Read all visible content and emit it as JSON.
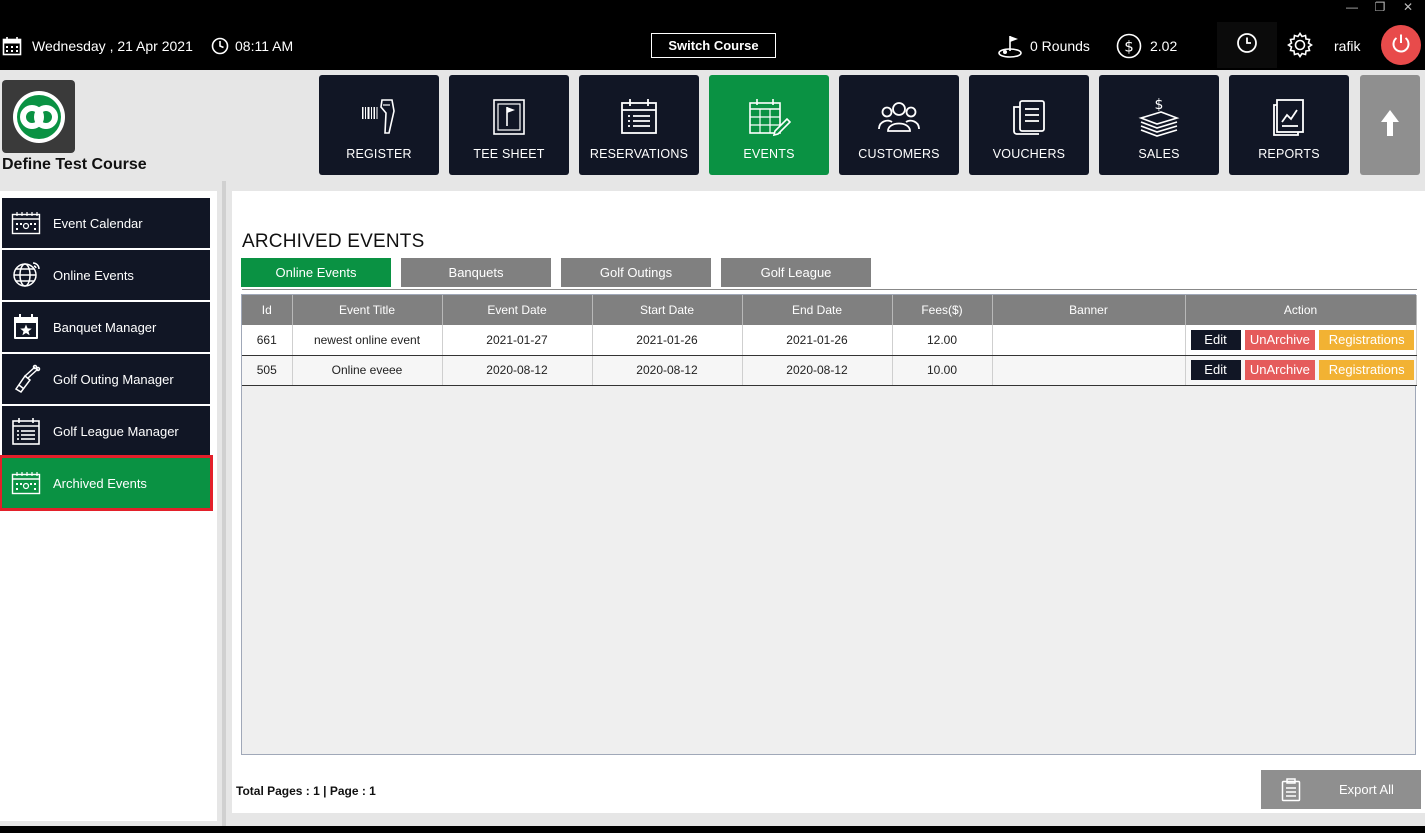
{
  "topbar": {
    "date": "Wednesday ,  21 Apr 2021",
    "time": "08:11 AM",
    "switch_course": "Switch Course",
    "rounds": "0 Rounds",
    "balance": "2.02",
    "user": "rafik",
    "window_controls": [
      "minimize-icon",
      "restore-icon",
      "close-icon"
    ]
  },
  "header": {
    "course_name": "Define Test Course",
    "nav": [
      {
        "label": "REGISTER",
        "icon": "barcode-scanner-icon"
      },
      {
        "label": "TEE SHEET",
        "icon": "flag-sheet-icon"
      },
      {
        "label": "RESERVATIONS",
        "icon": "calendar-list-icon"
      },
      {
        "label": "EVENTS",
        "icon": "calendar-edit-icon",
        "active": true
      },
      {
        "label": "CUSTOMERS",
        "icon": "people-icon"
      },
      {
        "label": "VOUCHERS",
        "icon": "voucher-icon"
      },
      {
        "label": "SALES",
        "icon": "money-stack-icon"
      },
      {
        "label": "REPORTS",
        "icon": "report-icon"
      }
    ]
  },
  "sidebar": {
    "items": [
      {
        "label": "Event Calendar",
        "icon": "calendar-icon"
      },
      {
        "label": "Online Events",
        "icon": "globe-icon"
      },
      {
        "label": "Banquet Manager",
        "icon": "calendar-star-icon"
      },
      {
        "label": "Golf Outing Manager",
        "icon": "golf-bag-icon"
      },
      {
        "label": "Golf League Manager",
        "icon": "calendar-list-icon"
      },
      {
        "label": "Archived Events",
        "icon": "calendar-icon",
        "active": true
      }
    ]
  },
  "main": {
    "title": "ARCHIVED EVENTS",
    "tabs": [
      {
        "label": "Online Events",
        "active": true
      },
      {
        "label": "Banquets"
      },
      {
        "label": "Golf Outings"
      },
      {
        "label": "Golf League"
      }
    ],
    "table": {
      "columns": [
        "Id",
        "Event Title",
        "Event Date",
        "Start Date",
        "End Date",
        "Fees($)",
        "Banner",
        "Action"
      ],
      "rows": [
        {
          "id": "661",
          "title": "newest online event",
          "event_date": "2021-01-27",
          "start_date": "2021-01-26",
          "end_date": "2021-01-26",
          "fees": "12.00",
          "banner": ""
        },
        {
          "id": "505",
          "title": "Online eveee",
          "event_date": "2020-08-12",
          "start_date": "2020-08-12",
          "end_date": "2020-08-12",
          "fees": "10.00",
          "banner": ""
        }
      ],
      "actions": {
        "edit": "Edit",
        "unarchive": "UnArchive",
        "registrations": "Registrations"
      }
    },
    "pager": "Total Pages : 1 | Page : 1",
    "export_label": "Export All"
  },
  "colors": {
    "accent_green": "#0a9243",
    "navy": "#111625",
    "danger": "#e55b5b",
    "warning": "#f2b233",
    "power": "#e84b4b"
  }
}
